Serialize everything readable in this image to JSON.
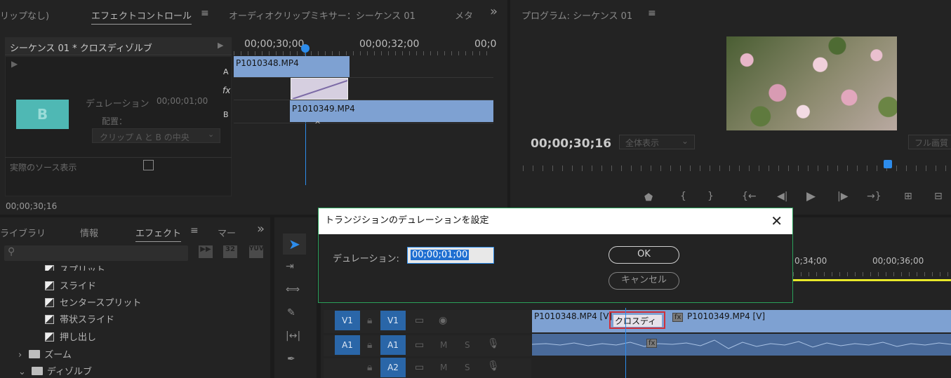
{
  "top_left_panel": {
    "tabs": [
      "リップなし)",
      "エフェクトコントロール",
      "オーディオクリップミキサー：シーケンス 01",
      "メタ"
    ],
    "header": "シーケンス 01 * クロスディゾルブ",
    "duration_label": "デュレーション",
    "duration_value": "00;00;01;00",
    "alignment_label": "配置：",
    "alignment_value": "クリップ A と B の中央",
    "show_actual_sources": "実際のソース表示",
    "bottom_timecode": "00;00;30;16",
    "thumb_letter": "B",
    "ruler_times": [
      "00;00;30;00",
      "00;00;32;00",
      "00;0"
    ],
    "track_labels": [
      "A",
      "fx",
      "B"
    ],
    "clip_a": "P1010348.MP4",
    "clip_b": "P1010349.MP4"
  },
  "program_monitor": {
    "title": "プログラム: シーケンス 01",
    "timecode": "00;00;30;16",
    "fit_label": "全体表示",
    "quality_label": "フル画質"
  },
  "project_panel": {
    "tabs": [
      "ライブラリ",
      "情報",
      "エフェクト",
      "マー"
    ],
    "items": [
      "スプリット",
      "スライド",
      "センタースプリット",
      "帯状スライド",
      "押し出し"
    ],
    "folders": [
      "ズーム",
      "ディゾルブ"
    ]
  },
  "timeline": {
    "ruler_times": [
      "0;34;00",
      "00;00;36;00"
    ],
    "tracks": [
      {
        "src": "V1",
        "dst": "V1"
      },
      {
        "src": "A1",
        "dst": "A1"
      },
      {
        "src": "",
        "dst": "A2"
      }
    ],
    "track_m": "M",
    "track_s": "S",
    "clip_v1_a": "P1010348.MP4 [V]",
    "clip_v1_b": "P1010349.MP4 [V]",
    "transition_label": "クロスディ",
    "fx_badge": "fx"
  },
  "dialog": {
    "title": "トランジションのデュレーションを設定",
    "duration_label": "デュレーション:",
    "duration_value": "00;00;01;00",
    "ok_label": "OK",
    "cancel_label": "キャンセル"
  },
  "colors": {
    "clip_blue": "#7ea1d2",
    "track_blue": "#2a66a8",
    "playhead": "#2d8ceb",
    "dialog_border": "#2aa05a",
    "highlight_red": "#d0303a"
  }
}
